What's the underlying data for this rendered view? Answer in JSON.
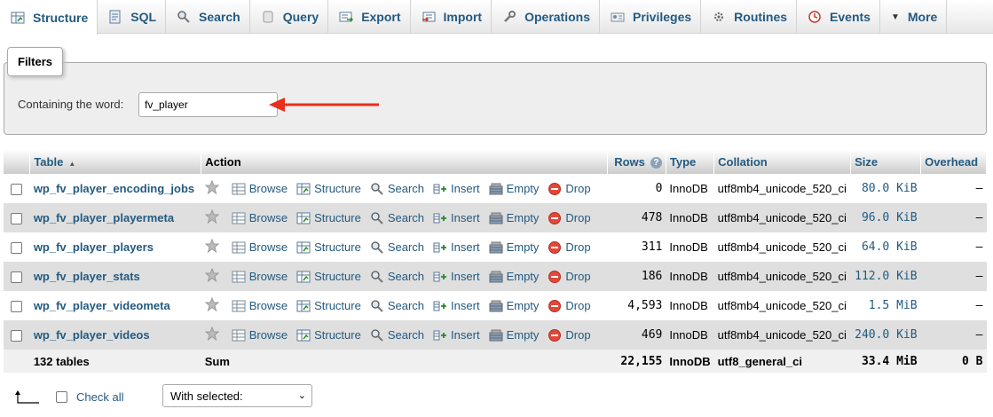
{
  "tabs": [
    {
      "label": "Structure",
      "icon": "structure-icon",
      "active": true
    },
    {
      "label": "SQL",
      "icon": "sql-icon"
    },
    {
      "label": "Search",
      "icon": "search-icon"
    },
    {
      "label": "Query",
      "icon": "query-icon"
    },
    {
      "label": "Export",
      "icon": "export-icon"
    },
    {
      "label": "Import",
      "icon": "import-icon"
    },
    {
      "label": "Operations",
      "icon": "wrench-icon"
    },
    {
      "label": "Privileges",
      "icon": "privileges-icon"
    },
    {
      "label": "Routines",
      "icon": "routines-icon"
    },
    {
      "label": "Events",
      "icon": "events-icon"
    },
    {
      "label": "More",
      "icon": "caret-down-icon"
    }
  ],
  "filters": {
    "legend": "Filters",
    "label": "Containing the word:",
    "value": "fv_player"
  },
  "table": {
    "headers": {
      "table": "Table",
      "action": "Action",
      "rows": "Rows",
      "type": "Type",
      "collation": "Collation",
      "size": "Size",
      "overhead": "Overhead"
    },
    "actions": [
      "Browse",
      "Structure",
      "Search",
      "Insert",
      "Empty",
      "Drop"
    ],
    "rows": [
      {
        "name": "wp_fv_player_encoding_jobs",
        "rows": "0",
        "type": "InnoDB",
        "collation": "utf8mb4_unicode_520_ci",
        "size": "80.0 KiB",
        "overhead": "–"
      },
      {
        "name": "wp_fv_player_playermeta",
        "rows": "478",
        "type": "InnoDB",
        "collation": "utf8mb4_unicode_520_ci",
        "size": "96.0 KiB",
        "overhead": "–"
      },
      {
        "name": "wp_fv_player_players",
        "rows": "311",
        "type": "InnoDB",
        "collation": "utf8mb4_unicode_520_ci",
        "size": "64.0 KiB",
        "overhead": "–"
      },
      {
        "name": "wp_fv_player_stats",
        "rows": "186",
        "type": "InnoDB",
        "collation": "utf8mb4_unicode_520_ci",
        "size": "112.0 KiB",
        "overhead": "–"
      },
      {
        "name": "wp_fv_player_videometa",
        "rows": "4,593",
        "type": "InnoDB",
        "collation": "utf8mb4_unicode_520_ci",
        "size": "1.5 MiB",
        "overhead": "–"
      },
      {
        "name": "wp_fv_player_videos",
        "rows": "469",
        "type": "InnoDB",
        "collation": "utf8mb4_unicode_520_ci",
        "size": "240.0 KiB",
        "overhead": "–"
      }
    ],
    "footer": {
      "tables": "132 tables",
      "sum": "Sum",
      "rows": "22,155",
      "type": "InnoDB",
      "collation": "utf8_general_ci",
      "size": "33.4 MiB",
      "overhead": "0 B"
    }
  },
  "bottom": {
    "check_all": "Check all",
    "with_selected": "With selected:"
  },
  "colors": {
    "link": "#235a81",
    "drop": "#c0392b",
    "arrow": "#e8301c"
  }
}
